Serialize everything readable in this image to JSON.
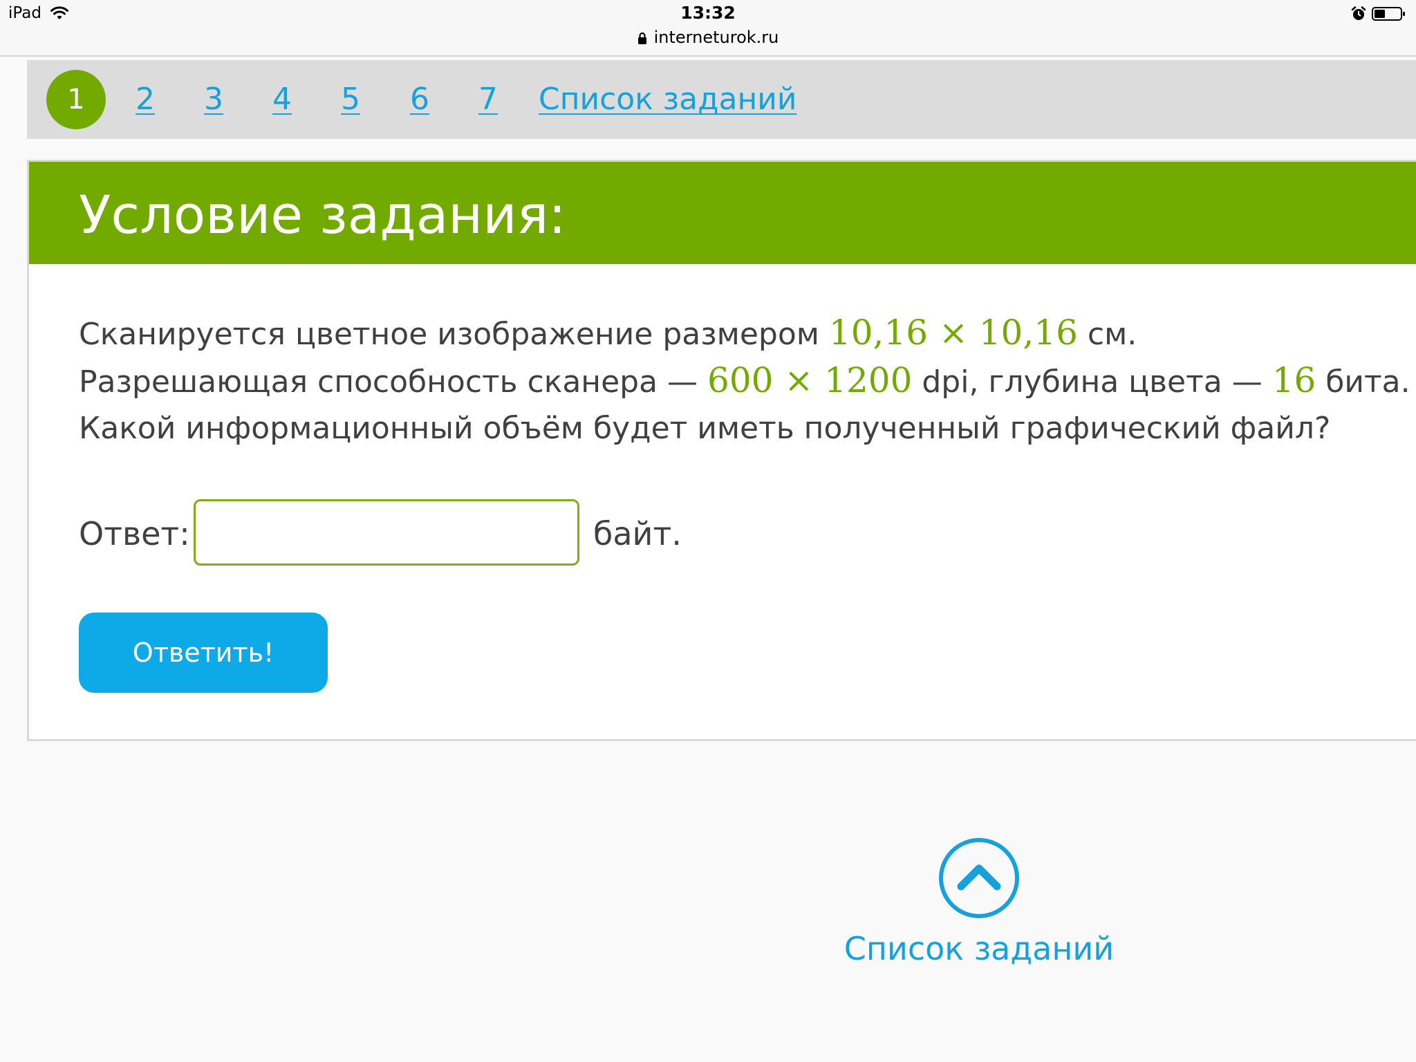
{
  "status_bar": {
    "device": "iPad",
    "time": "13:32",
    "url": "interneturok.ru"
  },
  "task_nav": {
    "current": "1",
    "links": [
      {
        "label": "2"
      },
      {
        "label": "3"
      },
      {
        "label": "4"
      },
      {
        "label": "5"
      },
      {
        "label": "6"
      },
      {
        "label": "7"
      },
      {
        "label": "Список заданий"
      }
    ]
  },
  "task": {
    "heading": "Условие задания:",
    "line1_text": "Сканируется цветное изображение размером ",
    "line1_math": "10,16 × 10,16",
    "line1_end": " см.",
    "line2_text": "Разрешающая способность сканера — ",
    "line2_math1": "600 × 1200",
    "line2_mid": " dpi, глубина цвета — ",
    "line2_math2": "16",
    "line2_end": " бита.",
    "line3_text": "Какой информационный объём будет иметь полученный графический файл?",
    "answer_label": "Ответ:",
    "answer_value": "",
    "answer_unit": "байт.",
    "submit_label": "Ответить!"
  },
  "bottom": {
    "list_label": "Список заданий"
  },
  "colors": {
    "accent_green": "#72aa00",
    "link_blue": "#14a1dc",
    "button_blue": "#0eaae8",
    "text": "#404040"
  }
}
